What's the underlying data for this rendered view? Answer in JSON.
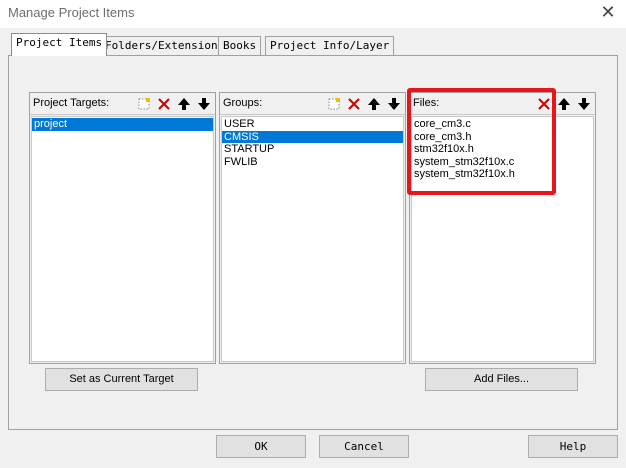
{
  "window": {
    "title": "Manage Project Items"
  },
  "tabs": [
    {
      "label": "Project Items",
      "active": true
    },
    {
      "label": "Folders/Extensions",
      "active": false
    },
    {
      "label": "Books",
      "active": false
    },
    {
      "label": "Project Info/Layer",
      "active": false
    }
  ],
  "targets": {
    "label": "Project Targets:",
    "items": [
      "project"
    ],
    "selected_index": 0,
    "set_current_button": "Set as Current Target"
  },
  "groups": {
    "label": "Groups:",
    "items": [
      "USER",
      "CMSIS",
      "STARTUP",
      "FWLIB"
    ],
    "selected_index": 1
  },
  "files": {
    "label": "Files:",
    "items": [
      "core_cm3.c",
      "core_cm3.h",
      "stm32f10x.h",
      "system_stm32f10x.c",
      "system_stm32f10x.h"
    ],
    "add_files_button": "Add Files..."
  },
  "footer": {
    "ok": "OK",
    "cancel": "Cancel",
    "help": "Help"
  },
  "colors": {
    "selection": "#0078d7",
    "delete_icon": "#c80000",
    "highlight_box": "#e8151d"
  }
}
